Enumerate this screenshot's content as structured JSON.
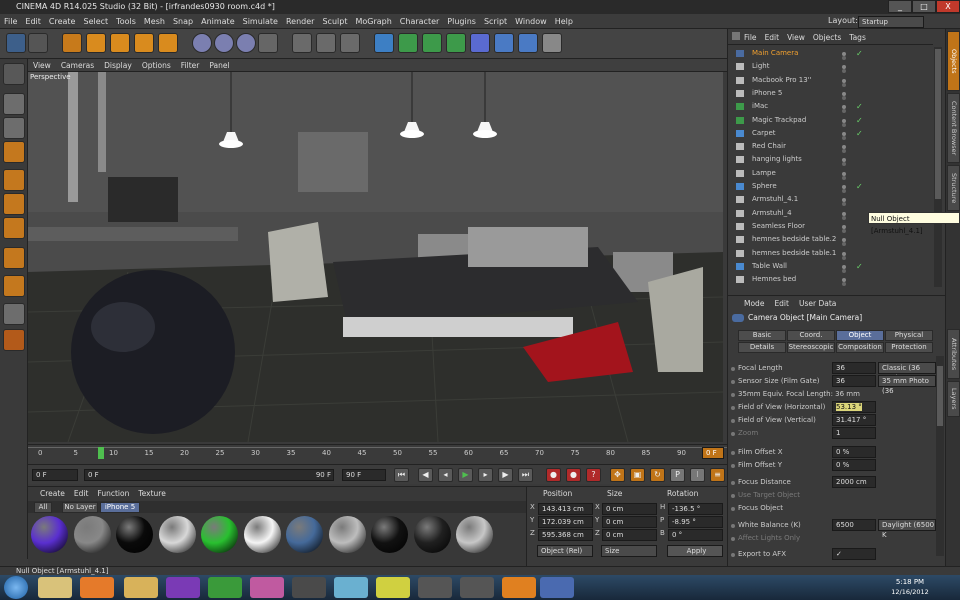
{
  "window": {
    "title": "CINEMA 4D R14.025 Studio (32 Bit) - [irfrandes0930 room.c4d *]",
    "layout_label": "Layout:",
    "layout_value": "Startup",
    "min": "_",
    "max": "□",
    "close": "X"
  },
  "menu": [
    "File",
    "Edit",
    "Create",
    "Select",
    "Tools",
    "Mesh",
    "Snap",
    "Animate",
    "Simulate",
    "Render",
    "Sculpt",
    "MoGraph",
    "Character",
    "Plugins",
    "Script",
    "Window",
    "Help"
  ],
  "viewport": {
    "menu": [
      "View",
      "Cameras",
      "Display",
      "Options",
      "Filter",
      "Panel"
    ],
    "label": "Perspective"
  },
  "timeline": {
    "ticks": [
      "0",
      "5",
      "10",
      "15",
      "20",
      "25",
      "30",
      "35",
      "40",
      "45",
      "50",
      "55",
      "60",
      "65",
      "70",
      "75",
      "80",
      "85",
      "90"
    ],
    "current": "8",
    "end_marker": "0 F"
  },
  "transport": {
    "start": "0 F",
    "current": "0 F",
    "end_small": "90 F",
    "end": "90 F"
  },
  "materials": {
    "menu": [
      "Create",
      "Edit",
      "Function",
      "Texture"
    ],
    "filters": [
      "All",
      "No Layer",
      "iPhone 5"
    ],
    "colors": [
      "#5a2fd0",
      "#888888",
      "#0a0a0a",
      "#d8d8d8",
      "#29c030",
      "#f5f5f5",
      "#456a9a",
      "#bdbdbd",
      "#111111",
      "#202020",
      "#c7c7c7"
    ]
  },
  "coords": {
    "headers": [
      "Position",
      "Size",
      "Rotation"
    ],
    "rows": [
      {
        "axis": "X",
        "pos": "143.413 cm",
        "saxis": "X",
        "size": "0 cm",
        "raxis": "H",
        "rot": "-136.5 °"
      },
      {
        "axis": "Y",
        "pos": "172.039 cm",
        "saxis": "Y",
        "size": "0 cm",
        "raxis": "P",
        "rot": "-8.95 °"
      },
      {
        "axis": "Z",
        "pos": "595.368 cm",
        "saxis": "Z",
        "size": "0 cm",
        "raxis": "B",
        "rot": "0 °"
      }
    ],
    "mode": "Object (Rel)",
    "size_mode": "Size",
    "apply": "Apply"
  },
  "objects": {
    "menu": [
      "File",
      "Edit",
      "View",
      "Objects",
      "Tags"
    ],
    "items": [
      "Main Camera",
      "Light",
      "Macbook Pro 13''",
      "iPhone 5",
      "iMac",
      "Magic Trackpad",
      "Carpet",
      "Red Chair",
      "hanging lights",
      "Lampe",
      "Sphere",
      "Armstuhl_4.1",
      "Armstuhl_4",
      "Seamless Floor",
      "hemnes bedside table.2",
      "hemnes bedside table.1",
      "Table Wall",
      "Hemnes bed"
    ],
    "tooltip": "Null Object [Armstuhl_4.1]"
  },
  "attributes": {
    "menu": [
      "Mode",
      "Edit",
      "User Data"
    ],
    "title": "Camera Object [Main Camera]",
    "tabs_row1": [
      "Basic",
      "Coord.",
      "Object",
      "Physical"
    ],
    "tabs_row2": [
      "Details",
      "Stereoscopic",
      "Composition",
      "Protection"
    ],
    "rows": [
      {
        "label": "Focal Length",
        "value": "36",
        "extra": "Classic (36 mm)"
      },
      {
        "label": "Sensor Size (Film Gate)",
        "value": "36",
        "extra": "35 mm Photo (36"
      },
      {
        "label": "35mm Equiv. Focal Length: 36 mm",
        "value": "",
        "extra": ""
      },
      {
        "label": "Field of View (Horizontal)",
        "value": "53.13 °",
        "extra": ""
      },
      {
        "label": "Field of View (Vertical)",
        "value": "31.417 °",
        "extra": ""
      },
      {
        "label": "Zoom",
        "value": "1",
        "extra": ""
      },
      {
        "label": "Film Offset X",
        "value": "0 %",
        "extra": ""
      },
      {
        "label": "Film Offset Y",
        "value": "0 %",
        "extra": ""
      },
      {
        "label": "Focus Distance",
        "value": "2000 cm",
        "extra": ""
      },
      {
        "label": "Use Target Object",
        "value": "",
        "extra": ""
      },
      {
        "label": "Focus Object",
        "value": "",
        "extra": ""
      },
      {
        "label": "White Balance (K)",
        "value": "6500",
        "extra": "Daylight (6500 K"
      },
      {
        "label": "Affect Lights Only",
        "value": "",
        "extra": ""
      },
      {
        "label": "Export to AFX",
        "value": "✓",
        "extra": ""
      }
    ]
  },
  "side_tabs": [
    "Objects",
    "Content Browser",
    "Structure",
    "Attributes",
    "Layers"
  ],
  "status": "Null Object [Armstuhl_4.1]",
  "clock": {
    "time": "5:18 PM",
    "date": "12/16/2012"
  }
}
